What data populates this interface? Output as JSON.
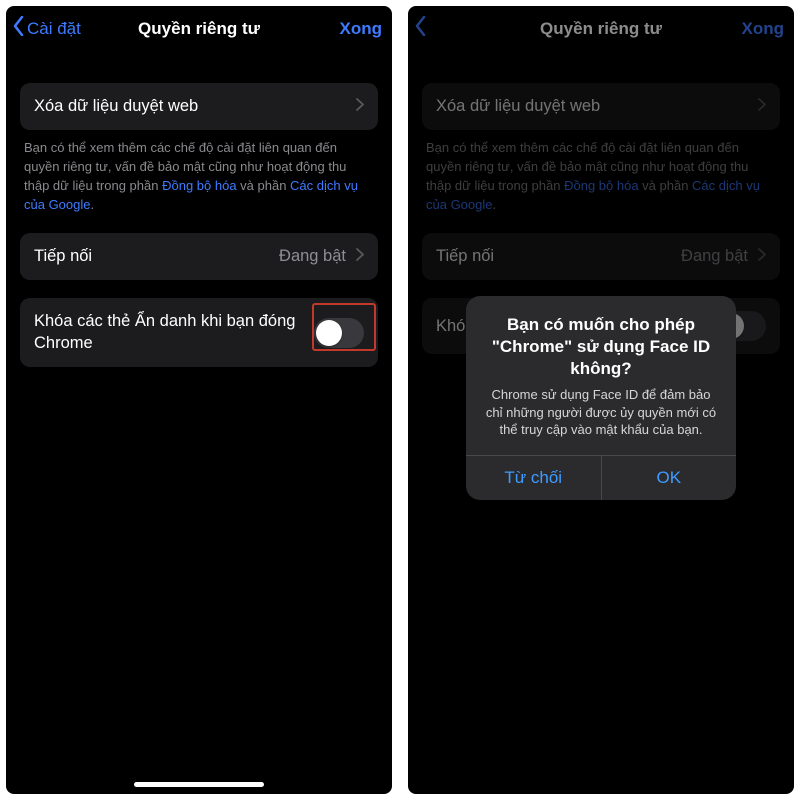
{
  "nav": {
    "back_label": "Cài đặt",
    "title": "Quyền riêng tư",
    "done_label": "Xong"
  },
  "row_clear": {
    "label": "Xóa dữ liệu duyệt web"
  },
  "desc": {
    "prefix": "Bạn có thể xem thêm các chế độ cài đặt liên quan đến quyền riêng tư, vấn đề bảo mật cũng như hoạt động thu thập dữ liệu trong phần ",
    "link1": "Đồng bộ hóa",
    "mid": " và phần ",
    "link2": "Các dịch vụ của Google",
    "suffix": "."
  },
  "row_handoff": {
    "label": "Tiếp nối",
    "value": "Đang bật"
  },
  "row_lock": {
    "label": "Khóa các thẻ Ẩn danh khi bạn đóng Chrome"
  },
  "alert": {
    "title": "Bạn có muốn cho phép \"Chrome\" sử dụng Face ID không?",
    "message": "Chrome sử dụng Face ID để đảm bảo chỉ những người được ủy quyền mới có thể truy cập vào mật khẩu của bạn.",
    "deny": "Từ chối",
    "ok": "OK"
  },
  "right_lock_prefix": "Khó"
}
